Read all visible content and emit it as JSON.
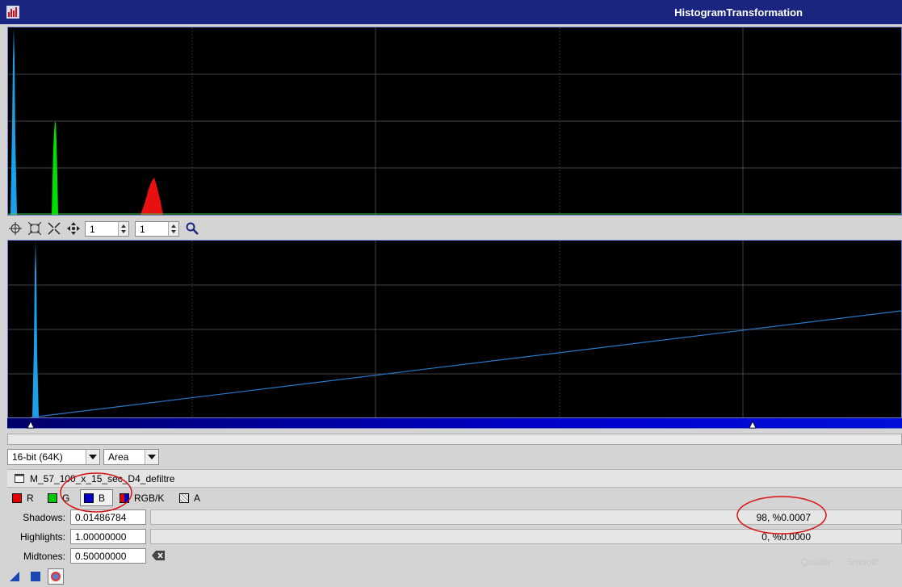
{
  "window": {
    "title": "HistogramTransformation"
  },
  "zoom": {
    "horizontal": "1",
    "vertical": "1"
  },
  "icons": {
    "toolbar": [
      "crosshair-icon",
      "fit-icon",
      "collapse-icon",
      "pan-icon",
      "zoom-icon"
    ],
    "bottom": [
      "new-instance-icon",
      "apply-global-icon",
      "preview-icon"
    ]
  },
  "settings": {
    "resolution": "16-bit (64K)",
    "graph_style": "Area"
  },
  "view": {
    "image_name": "M_57_100_x_15_sec_D4_defiltre"
  },
  "channels": [
    {
      "label": "R",
      "color": "#e00000"
    },
    {
      "label": "G",
      "color": "#00c800"
    },
    {
      "label": "B",
      "color": "#0000c8"
    },
    {
      "label": "RGB/K",
      "color": "#444444"
    },
    {
      "label": "A",
      "color": "#ffffff"
    }
  ],
  "params": {
    "shadows_label": "Shadows:",
    "shadows_value": "0.01486784",
    "shadows_clip": "98, %0.0007",
    "highlights_label": "Highlights:",
    "highlights_value": "1.00000000",
    "highlights_clip": "0, %0.0000",
    "midtones_label": "Midtones:",
    "midtones_value": "0.50000000"
  },
  "background_hint": {
    "quality_label": "Quality:",
    "quality_value": "Smooth"
  },
  "colors": {
    "blue": "#1aa0e8",
    "green": "#00e000",
    "red": "#e81010",
    "curve": "#2878c8",
    "annotation": "#d81010"
  }
}
